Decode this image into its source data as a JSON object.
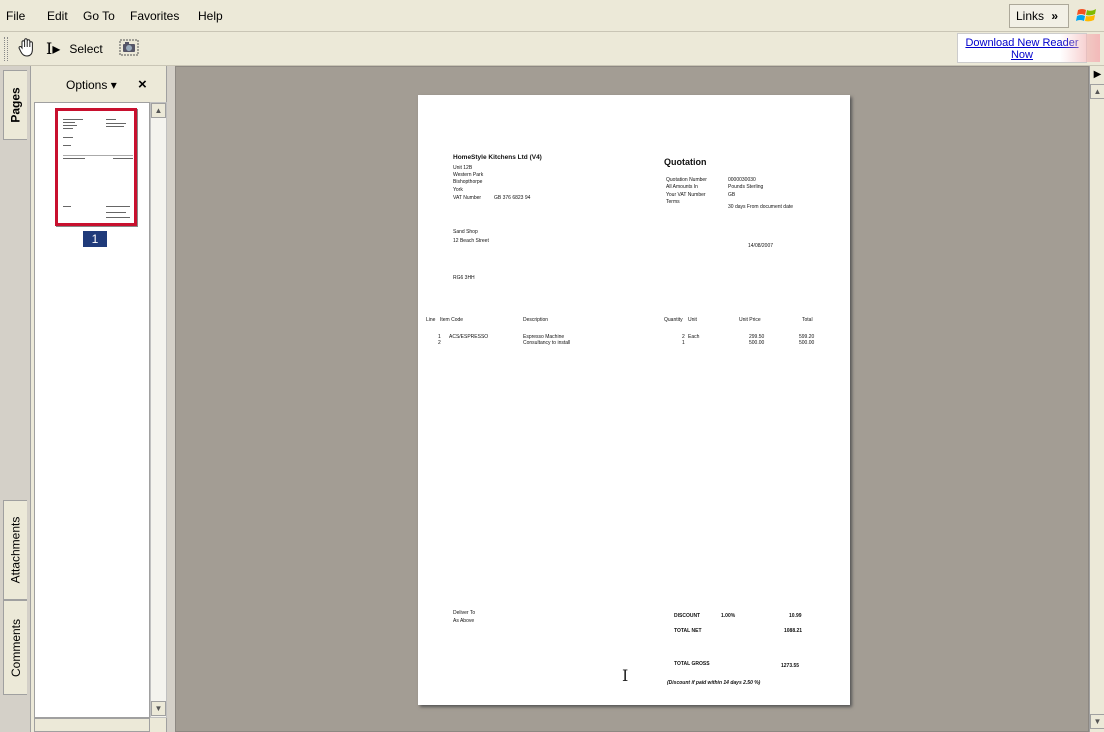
{
  "menu": {
    "file": "File",
    "edit": "Edit",
    "goto": "Go To",
    "favorites": "Favorites",
    "help": "Help",
    "links": "Links",
    "links_chevron": "»"
  },
  "toolbar": {
    "select_label": "Select",
    "download_line1": "Download New Reader",
    "download_line2": "Now"
  },
  "tabs": {
    "pages": "Pages",
    "attachments": "Attachments",
    "comments": "Comments"
  },
  "nav": {
    "options": "Options",
    "dropdown": "▾",
    "close": "×",
    "page_number": "1"
  },
  "doc": {
    "company": "HomeStyle Kitchens Ltd  (V4)",
    "address": [
      "Unit 12B",
      "Western Park",
      "Bishopthorpe",
      "York"
    ],
    "vat_label": "VAT Number",
    "vat_value": "GB   376 6823 94",
    "title": "Quotation",
    "info_labels": [
      "Quotation Number",
      "All Amounts In",
      "Your VAT Number",
      "Terms"
    ],
    "info_values": [
      "0000030030",
      "Pounds Sterling",
      "GB",
      "30 days From document date"
    ],
    "customer": [
      "Sand Shop",
      "12 Beach Street"
    ],
    "date": "14/08/2007",
    "postcode": "RG6 3HH",
    "headers": {
      "line": "Line",
      "item_code": "Item Code",
      "description": "Description",
      "quantity": "Quantity",
      "unit": "Unit",
      "unit_price": "Unit Price",
      "total": "Total"
    },
    "rows": [
      {
        "line": "1",
        "code": "ACS/ESPRESSO",
        "desc": "Espresso Machine",
        "qty": "2",
        "unit": "Each",
        "price": "299.50",
        "total": "599.20"
      },
      {
        "line": "2",
        "code": "",
        "desc": "Consultancy to install",
        "qty": "1",
        "unit": "",
        "price": "500.00",
        "total": "500.00"
      }
    ],
    "deliver_to": "Deliver To",
    "deliver_value": "As Above",
    "discount_label": "DISCOUNT",
    "discount_pct": "1.00%",
    "discount_value": "10.99",
    "total_net_label": "TOTAL NET",
    "total_net_value": "1088.21",
    "total_gross_label": "TOTAL GROSS",
    "total_gross_value": "1273.55",
    "footnote": "(Discount if paid within    14    days  2.50   %)"
  }
}
